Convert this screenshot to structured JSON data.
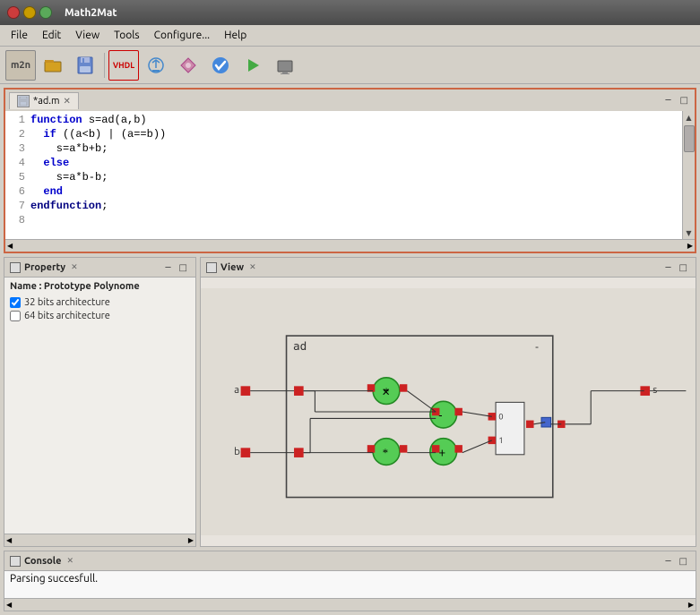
{
  "titlebar": {
    "title": "Math2Mat"
  },
  "menubar": {
    "items": [
      "File",
      "Edit",
      "View",
      "Tools",
      "Configure...",
      "Help"
    ]
  },
  "toolbar": {
    "buttons": [
      {
        "name": "m2n-button",
        "icon": "🔢"
      },
      {
        "name": "open-button",
        "icon": "📂"
      },
      {
        "name": "save-button",
        "icon": "💾"
      },
      {
        "name": "vhdl-button",
        "icon": "📝"
      },
      {
        "name": "import-button",
        "icon": "📥"
      },
      {
        "name": "diamond-button",
        "icon": "◆"
      },
      {
        "name": "check-button",
        "icon": "✔"
      },
      {
        "name": "run-button",
        "icon": "▶"
      },
      {
        "name": "device-button",
        "icon": "🖨"
      }
    ]
  },
  "editor": {
    "tab_label": "*ad.m",
    "tab_icon": "📄",
    "lines": [
      {
        "num": "1",
        "text": "function s=ad(a,b)",
        "parts": [
          {
            "t": "kw",
            "v": "function "
          },
          {
            "t": "n",
            "v": "s=ad(a,b)"
          }
        ]
      },
      {
        "num": "2",
        "text": "  if ((a<b) | (a==b))",
        "parts": [
          {
            "t": "kw",
            "v": "  if "
          },
          {
            "t": "n",
            "v": "((a<b) | (a==b))"
          }
        ]
      },
      {
        "num": "3",
        "text": "    s=a*b+b;",
        "parts": [
          {
            "t": "n",
            "v": "    s=a*b+b;"
          }
        ]
      },
      {
        "num": "4",
        "text": "  else",
        "parts": [
          {
            "t": "kw",
            "v": "  else"
          }
        ]
      },
      {
        "num": "5",
        "text": "    s=a*b-b;",
        "parts": [
          {
            "t": "n",
            "v": "    s=a*b-b;"
          }
        ]
      },
      {
        "num": "6",
        "text": "  end",
        "parts": [
          {
            "t": "kw",
            "v": "  end"
          }
        ]
      },
      {
        "num": "7",
        "text": "endfunction;",
        "parts": [
          {
            "t": "fn",
            "v": "endfunction"
          },
          {
            "t": "n",
            "v": ";"
          }
        ]
      }
    ]
  },
  "property_panel": {
    "title": "Property",
    "name_label": "Name : Prototype Polynome",
    "checkboxes": [
      {
        "label": "32 bits architecture",
        "checked": true
      },
      {
        "label": "64 bits architecture",
        "checked": false
      }
    ]
  },
  "view_panel": {
    "title": "View"
  },
  "console_panel": {
    "title": "Console",
    "message": "Parsing succesfull."
  }
}
